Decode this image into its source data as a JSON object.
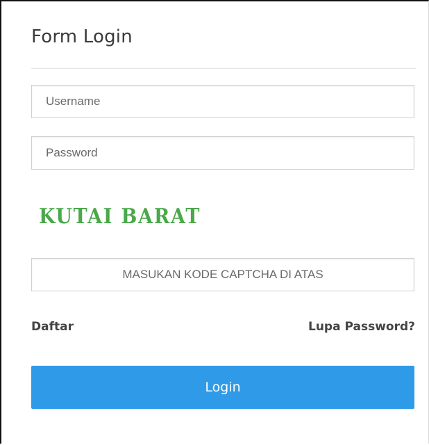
{
  "form": {
    "title": "Form Login",
    "username_placeholder": "Username",
    "password_placeholder": "Password",
    "captcha_text": "KUTAI BARAT",
    "captcha_placeholder": "MASUKAN KODE CAPTCHA DI ATAS",
    "register_link": "Daftar",
    "forgot_link": "Lupa Password?",
    "login_label": "Login"
  },
  "colors": {
    "primary": "#2f9be8",
    "captcha": "#4aa84a"
  }
}
